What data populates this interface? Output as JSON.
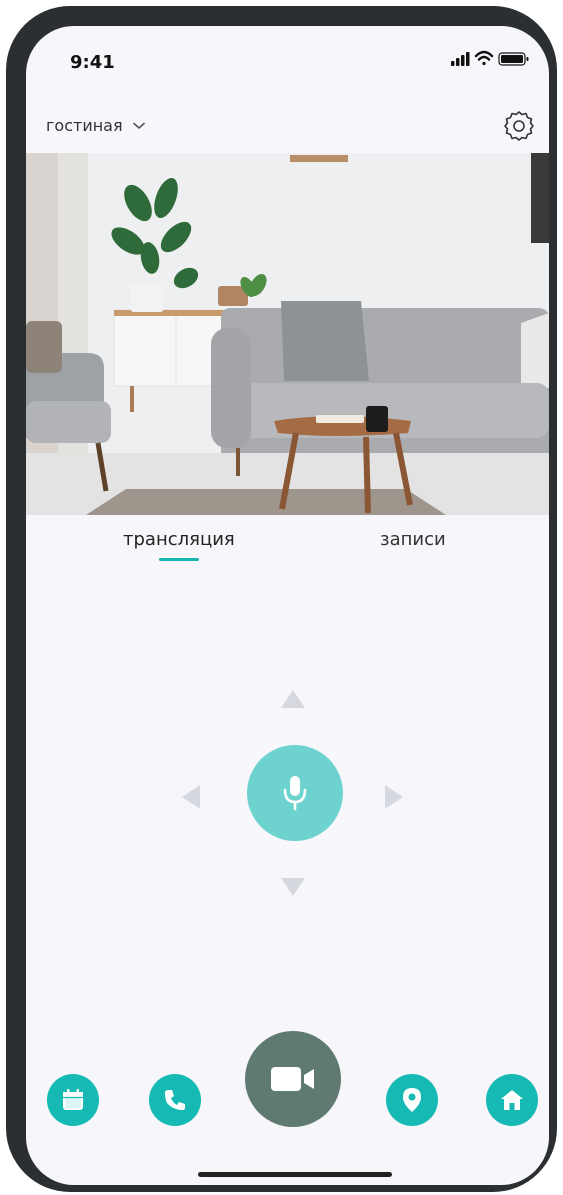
{
  "status_bar": {
    "time": "9:41"
  },
  "header": {
    "room_name": "гостиная"
  },
  "tabs": [
    {
      "label": "трансляция",
      "active": true
    },
    {
      "label": "записи",
      "active": false
    }
  ],
  "accent_color": "#16b9b3",
  "icons": {
    "settings": "gear-icon",
    "mic": "microphone-icon",
    "calendar": "calendar-icon",
    "phone": "phone-icon",
    "video": "video-camera-icon",
    "location": "location-pin-icon",
    "home": "home-icon"
  }
}
